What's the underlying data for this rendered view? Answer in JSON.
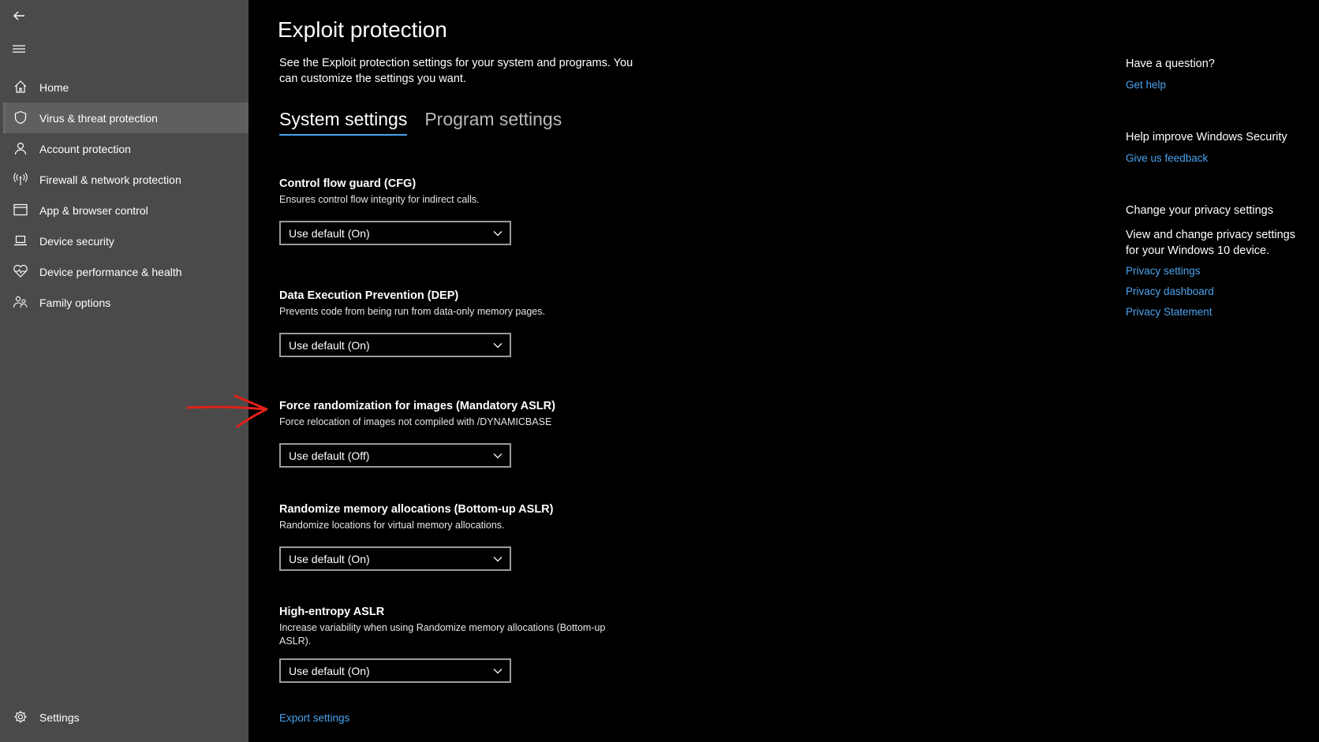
{
  "sidebar": {
    "items": [
      {
        "label": "Home",
        "icon": "home-icon"
      },
      {
        "label": "Virus & threat protection",
        "icon": "shield-icon",
        "active": true
      },
      {
        "label": "Account protection",
        "icon": "person-icon"
      },
      {
        "label": "Firewall & network protection",
        "icon": "antenna-icon"
      },
      {
        "label": "App & browser control",
        "icon": "browser-window-icon"
      },
      {
        "label": "Device security",
        "icon": "laptop-icon"
      },
      {
        "label": "Device performance & health",
        "icon": "heart-icon"
      },
      {
        "label": "Family options",
        "icon": "family-icon"
      }
    ],
    "settings_label": "Settings"
  },
  "main": {
    "title": "Exploit protection",
    "description": "See the Exploit protection settings for your system and programs.  You can customize the settings you want.",
    "tabs": [
      {
        "label": "System settings",
        "active": true
      },
      {
        "label": "Program settings",
        "active": false
      }
    ],
    "settings": [
      {
        "title": "Control flow guard (CFG)",
        "description": "Ensures control flow integrity for indirect calls.",
        "value": "Use default (On)"
      },
      {
        "title": "Data Execution Prevention (DEP)",
        "description": "Prevents code from being run from data-only memory pages.",
        "value": "Use default (On)"
      },
      {
        "title": "Force randomization for images (Mandatory ASLR)",
        "description": "Force relocation of images not compiled with /DYNAMICBASE",
        "value": "Use default (Off)"
      },
      {
        "title": "Randomize memory allocations (Bottom-up ASLR)",
        "description": "Randomize locations for virtual memory allocations.",
        "value": "Use default (On)"
      },
      {
        "title": "High-entropy ASLR",
        "description": "Increase variability when using Randomize memory allocations (Bottom-up ASLR).",
        "value": "Use default (On)"
      }
    ],
    "export_link": "Export settings"
  },
  "aside": {
    "question_heading": "Have a question?",
    "get_help": "Get help",
    "improve_heading": "Help improve Windows Security",
    "feedback": "Give us feedback",
    "privacy_heading": "Change your privacy settings",
    "privacy_text": "View and change privacy settings for your Windows 10 device.",
    "privacy_links": [
      "Privacy settings",
      "Privacy dashboard",
      "Privacy Statement"
    ]
  },
  "colors": {
    "accent": "#4aa3f0",
    "sidebar_bg": "#4a4a4a",
    "annotation_arrow": "#e0201a"
  }
}
